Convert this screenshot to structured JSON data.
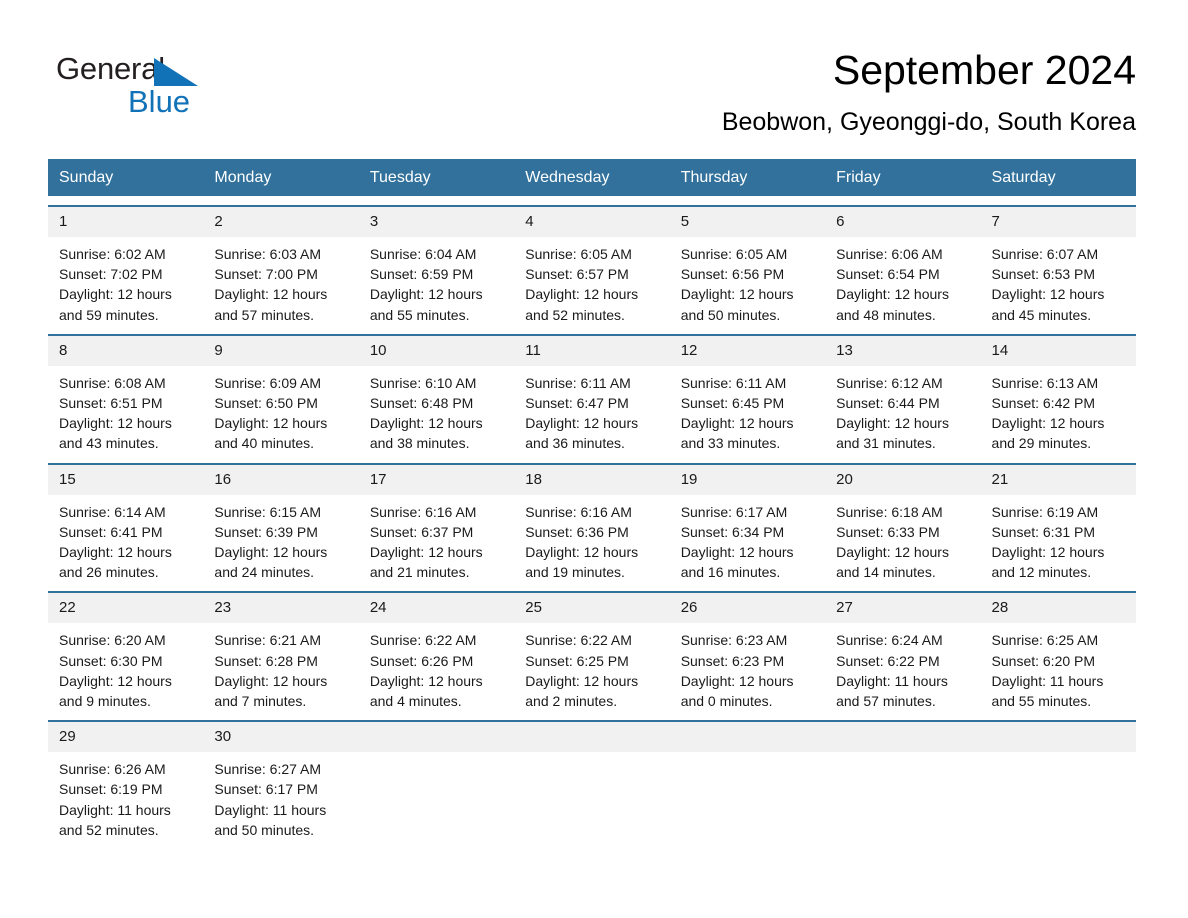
{
  "logo": {
    "primary_text": "General",
    "secondary_text": "Blue",
    "triangle_color": "#1272b8"
  },
  "header": {
    "month_title": "September 2024",
    "location": "Beobwon, Gyeonggi-do, South Korea"
  },
  "theme": {
    "header_blue": "#31719b",
    "cell_gray": "#f1f1f1",
    "text_dark": "#1a1a1a"
  },
  "weekdays": [
    "Sunday",
    "Monday",
    "Tuesday",
    "Wednesday",
    "Thursday",
    "Friday",
    "Saturday"
  ],
  "weeks": [
    [
      {
        "day": "1",
        "sunrise": "Sunrise: 6:02 AM",
        "sunset": "Sunset: 7:02 PM",
        "daylight": "Daylight: 12 hours and 59 minutes."
      },
      {
        "day": "2",
        "sunrise": "Sunrise: 6:03 AM",
        "sunset": "Sunset: 7:00 PM",
        "daylight": "Daylight: 12 hours and 57 minutes."
      },
      {
        "day": "3",
        "sunrise": "Sunrise: 6:04 AM",
        "sunset": "Sunset: 6:59 PM",
        "daylight": "Daylight: 12 hours and 55 minutes."
      },
      {
        "day": "4",
        "sunrise": "Sunrise: 6:05 AM",
        "sunset": "Sunset: 6:57 PM",
        "daylight": "Daylight: 12 hours and 52 minutes."
      },
      {
        "day": "5",
        "sunrise": "Sunrise: 6:05 AM",
        "sunset": "Sunset: 6:56 PM",
        "daylight": "Daylight: 12 hours and 50 minutes."
      },
      {
        "day": "6",
        "sunrise": "Sunrise: 6:06 AM",
        "sunset": "Sunset: 6:54 PM",
        "daylight": "Daylight: 12 hours and 48 minutes."
      },
      {
        "day": "7",
        "sunrise": "Sunrise: 6:07 AM",
        "sunset": "Sunset: 6:53 PM",
        "daylight": "Daylight: 12 hours and 45 minutes."
      }
    ],
    [
      {
        "day": "8",
        "sunrise": "Sunrise: 6:08 AM",
        "sunset": "Sunset: 6:51 PM",
        "daylight": "Daylight: 12 hours and 43 minutes."
      },
      {
        "day": "9",
        "sunrise": "Sunrise: 6:09 AM",
        "sunset": "Sunset: 6:50 PM",
        "daylight": "Daylight: 12 hours and 40 minutes."
      },
      {
        "day": "10",
        "sunrise": "Sunrise: 6:10 AM",
        "sunset": "Sunset: 6:48 PM",
        "daylight": "Daylight: 12 hours and 38 minutes."
      },
      {
        "day": "11",
        "sunrise": "Sunrise: 6:11 AM",
        "sunset": "Sunset: 6:47 PM",
        "daylight": "Daylight: 12 hours and 36 minutes."
      },
      {
        "day": "12",
        "sunrise": "Sunrise: 6:11 AM",
        "sunset": "Sunset: 6:45 PM",
        "daylight": "Daylight: 12 hours and 33 minutes."
      },
      {
        "day": "13",
        "sunrise": "Sunrise: 6:12 AM",
        "sunset": "Sunset: 6:44 PM",
        "daylight": "Daylight: 12 hours and 31 minutes."
      },
      {
        "day": "14",
        "sunrise": "Sunrise: 6:13 AM",
        "sunset": "Sunset: 6:42 PM",
        "daylight": "Daylight: 12 hours and 29 minutes."
      }
    ],
    [
      {
        "day": "15",
        "sunrise": "Sunrise: 6:14 AM",
        "sunset": "Sunset: 6:41 PM",
        "daylight": "Daylight: 12 hours and 26 minutes."
      },
      {
        "day": "16",
        "sunrise": "Sunrise: 6:15 AM",
        "sunset": "Sunset: 6:39 PM",
        "daylight": "Daylight: 12 hours and 24 minutes."
      },
      {
        "day": "17",
        "sunrise": "Sunrise: 6:16 AM",
        "sunset": "Sunset: 6:37 PM",
        "daylight": "Daylight: 12 hours and 21 minutes."
      },
      {
        "day": "18",
        "sunrise": "Sunrise: 6:16 AM",
        "sunset": "Sunset: 6:36 PM",
        "daylight": "Daylight: 12 hours and 19 minutes."
      },
      {
        "day": "19",
        "sunrise": "Sunrise: 6:17 AM",
        "sunset": "Sunset: 6:34 PM",
        "daylight": "Daylight: 12 hours and 16 minutes."
      },
      {
        "day": "20",
        "sunrise": "Sunrise: 6:18 AM",
        "sunset": "Sunset: 6:33 PM",
        "daylight": "Daylight: 12 hours and 14 minutes."
      },
      {
        "day": "21",
        "sunrise": "Sunrise: 6:19 AM",
        "sunset": "Sunset: 6:31 PM",
        "daylight": "Daylight: 12 hours and 12 minutes."
      }
    ],
    [
      {
        "day": "22",
        "sunrise": "Sunrise: 6:20 AM",
        "sunset": "Sunset: 6:30 PM",
        "daylight": "Daylight: 12 hours and 9 minutes."
      },
      {
        "day": "23",
        "sunrise": "Sunrise: 6:21 AM",
        "sunset": "Sunset: 6:28 PM",
        "daylight": "Daylight: 12 hours and 7 minutes."
      },
      {
        "day": "24",
        "sunrise": "Sunrise: 6:22 AM",
        "sunset": "Sunset: 6:26 PM",
        "daylight": "Daylight: 12 hours and 4 minutes."
      },
      {
        "day": "25",
        "sunrise": "Sunrise: 6:22 AM",
        "sunset": "Sunset: 6:25 PM",
        "daylight": "Daylight: 12 hours and 2 minutes."
      },
      {
        "day": "26",
        "sunrise": "Sunrise: 6:23 AM",
        "sunset": "Sunset: 6:23 PM",
        "daylight": "Daylight: 12 hours and 0 minutes."
      },
      {
        "day": "27",
        "sunrise": "Sunrise: 6:24 AM",
        "sunset": "Sunset: 6:22 PM",
        "daylight": "Daylight: 11 hours and 57 minutes."
      },
      {
        "day": "28",
        "sunrise": "Sunrise: 6:25 AM",
        "sunset": "Sunset: 6:20 PM",
        "daylight": "Daylight: 11 hours and 55 minutes."
      }
    ],
    [
      {
        "day": "29",
        "sunrise": "Sunrise: 6:26 AM",
        "sunset": "Sunset: 6:19 PM",
        "daylight": "Daylight: 11 hours and 52 minutes."
      },
      {
        "day": "30",
        "sunrise": "Sunrise: 6:27 AM",
        "sunset": "Sunset: 6:17 PM",
        "daylight": "Daylight: 11 hours and 50 minutes."
      },
      {
        "day": "",
        "sunrise": "",
        "sunset": "",
        "daylight": ""
      },
      {
        "day": "",
        "sunrise": "",
        "sunset": "",
        "daylight": ""
      },
      {
        "day": "",
        "sunrise": "",
        "sunset": "",
        "daylight": ""
      },
      {
        "day": "",
        "sunrise": "",
        "sunset": "",
        "daylight": ""
      },
      {
        "day": "",
        "sunrise": "",
        "sunset": "",
        "daylight": ""
      }
    ]
  ]
}
